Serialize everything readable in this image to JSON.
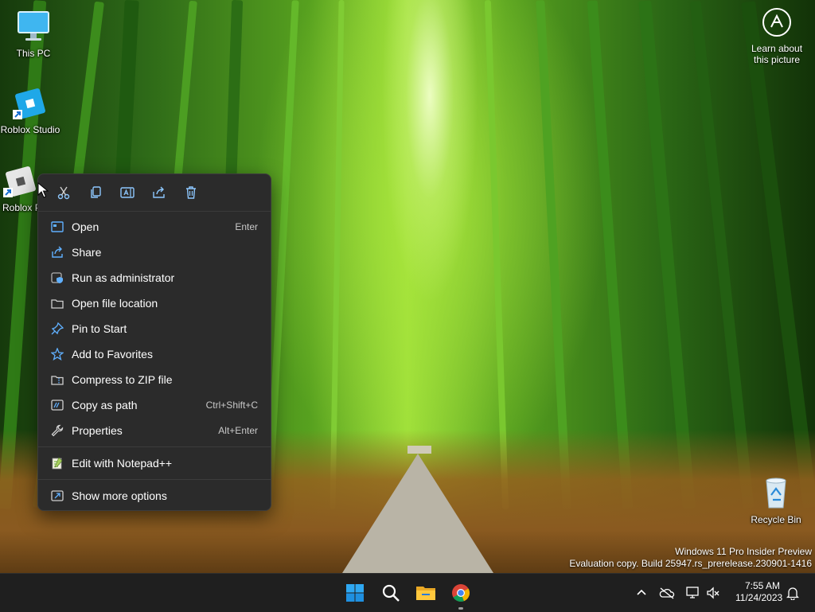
{
  "desktop": {
    "icons": [
      {
        "label": "This PC",
        "icon": "monitor-icon"
      },
      {
        "label": "Roblox Studio",
        "icon": "roblox-studio-icon"
      },
      {
        "label": "Roblox P",
        "icon": "roblox-player-icon"
      },
      {
        "label": "Recycle Bin",
        "icon": "recycle-bin-icon"
      }
    ],
    "learn_about": {
      "line1": "Learn about",
      "line2": "this picture"
    },
    "watermark": {
      "line1": "Windows 11 Pro Insider Preview",
      "line2": "Evaluation copy. Build 25947.rs_prerelease.230901-1416"
    }
  },
  "context_menu": {
    "quick_actions": [
      {
        "name": "cut",
        "icon": "scissors-icon"
      },
      {
        "name": "copy",
        "icon": "copy-icon"
      },
      {
        "name": "rename",
        "icon": "rename-icon"
      },
      {
        "name": "share",
        "icon": "share-icon"
      },
      {
        "name": "delete",
        "icon": "trash-icon"
      }
    ],
    "items": [
      {
        "label": "Open",
        "shortcut": "Enter",
        "icon": "open-icon"
      },
      {
        "label": "Share",
        "shortcut": "",
        "icon": "share-icon"
      },
      {
        "label": "Run as administrator",
        "shortcut": "",
        "icon": "shield-icon"
      },
      {
        "label": "Open file location",
        "shortcut": "",
        "icon": "folder-icon"
      },
      {
        "label": "Pin to Start",
        "shortcut": "",
        "icon": "pin-icon"
      },
      {
        "label": "Add to Favorites",
        "shortcut": "",
        "icon": "star-icon"
      },
      {
        "label": "Compress to ZIP file",
        "shortcut": "",
        "icon": "zip-icon"
      },
      {
        "label": "Copy as path",
        "shortcut": "Ctrl+Shift+C",
        "icon": "path-icon"
      },
      {
        "label": "Properties",
        "shortcut": "Alt+Enter",
        "icon": "wrench-icon"
      },
      {
        "label": "Edit with Notepad++",
        "shortcut": "",
        "icon": "notepad-plus-plus-icon"
      },
      {
        "label": "Show more options",
        "shortcut": "",
        "icon": "more-options-icon"
      }
    ]
  },
  "taskbar": {
    "apps": [
      "start-icon",
      "search-icon",
      "file-explorer-icon",
      "chrome-icon"
    ],
    "tray": [
      "chevron-up-icon",
      "onedrive-off-icon",
      "network-icon",
      "volume-muted-icon",
      "notification-bell-icon"
    ],
    "time": "7:55 AM",
    "date": "11/24/2023"
  },
  "colors": {
    "menu_bg": "#2b2b2b",
    "accent": "#60b0ff",
    "taskbar_bg": "#1f1f1f"
  }
}
